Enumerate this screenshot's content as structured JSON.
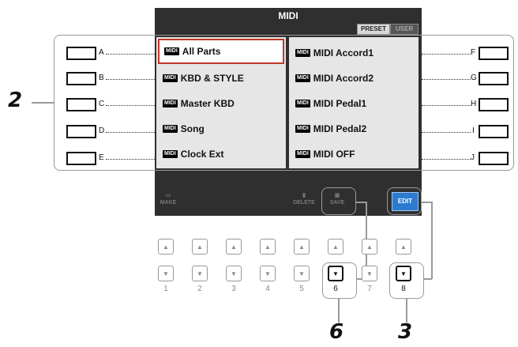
{
  "screen": {
    "title": "MIDI",
    "tabs": [
      "PRESET",
      "USER"
    ],
    "left_items": [
      "All Parts",
      "KBD & STYLE",
      "Master KBD",
      "Song",
      "Clock Ext"
    ],
    "right_items": [
      "MIDI Accord1",
      "MIDI Accord2",
      "MIDI Pedal1",
      "MIDI Pedal2",
      "MIDI OFF"
    ],
    "midi_logo": "MIDI",
    "selected_item": "All Parts",
    "soft_buttons": {
      "make_label": "MAKE",
      "delete_label": "DELETE",
      "save_label": "SAVE",
      "edit_label": "EDIT"
    }
  },
  "side_buttons": {
    "left": [
      "A",
      "B",
      "C",
      "D",
      "E"
    ],
    "right": [
      "F",
      "G",
      "H",
      "I",
      "J"
    ]
  },
  "bottom_buttons": {
    "numbers": [
      "1",
      "2",
      "3",
      "4",
      "5",
      "6",
      "7",
      "8"
    ],
    "up_glyph": "▲",
    "down_glyph": "▼"
  },
  "callouts": {
    "left": "2",
    "bottom_left": "6",
    "bottom_right": "3"
  }
}
